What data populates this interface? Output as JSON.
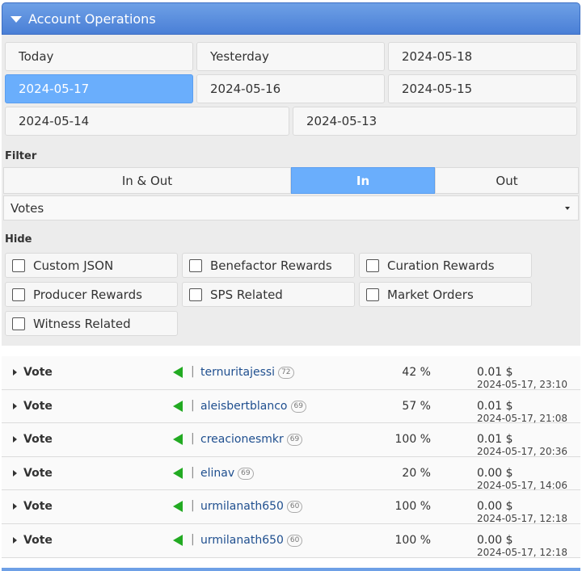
{
  "header": {
    "title": "Account Operations"
  },
  "dates": [
    "Today",
    "Yesterday",
    "2024-05-18",
    "2024-05-17",
    "2024-05-16",
    "2024-05-15",
    "2024-05-14",
    "2024-05-13"
  ],
  "selected_date": "2024-05-17",
  "filter": {
    "label": "Filter",
    "tabs": [
      "In & Out",
      "In",
      "Out"
    ],
    "active_tab": "In",
    "select_value": "Votes"
  },
  "hide": {
    "label": "Hide",
    "options": [
      "Custom JSON",
      "Benefactor Rewards",
      "Curation Rewards",
      "Producer Rewards",
      "SPS Related",
      "Market Orders",
      "Witness Related"
    ]
  },
  "colors": {
    "accent": "#6aaefc",
    "header": "#4a7fd6",
    "in_arrow": "#22aa22",
    "link": "#1f4f8f"
  },
  "operations": [
    {
      "type": "Vote",
      "user": "ternuritajessi",
      "rep": "72",
      "percent": "42 %",
      "amount": "0.01 $",
      "time": "2024-05-17, 23:10"
    },
    {
      "type": "Vote",
      "user": "aleisbertblanco",
      "rep": "69",
      "percent": "57 %",
      "amount": "0.01 $",
      "time": "2024-05-17, 21:08"
    },
    {
      "type": "Vote",
      "user": "creacionesmkr",
      "rep": "69",
      "percent": "100 %",
      "amount": "0.01 $",
      "time": "2024-05-17, 20:36"
    },
    {
      "type": "Vote",
      "user": "elinav",
      "rep": "69",
      "percent": "20 %",
      "amount": "0.00 $",
      "time": "2024-05-17, 14:06"
    },
    {
      "type": "Vote",
      "user": "urmilanath650",
      "rep": "60",
      "percent": "100 %",
      "amount": "0.00 $",
      "time": "2024-05-17, 12:18"
    },
    {
      "type": "Vote",
      "user": "urmilanath650",
      "rep": "60",
      "percent": "100 %",
      "amount": "0.00 $",
      "time": "2024-05-17, 12:18"
    }
  ]
}
